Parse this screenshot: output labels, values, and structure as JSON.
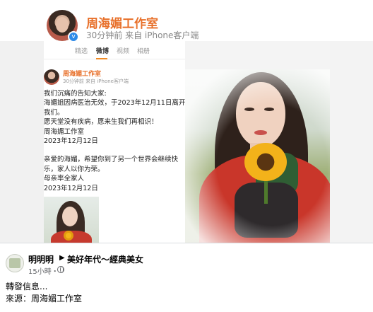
{
  "weibo_header": {
    "name": "周海媚工作室",
    "meta": "30分钟前 来自 iPhone客户端"
  },
  "tabs": [
    {
      "label": "精选"
    },
    {
      "label": "微博"
    },
    {
      "label": "视频"
    },
    {
      "label": "相册"
    }
  ],
  "post": {
    "name": "周海媚工作室",
    "meta": "30分钟前 来自 iPhone客户端",
    "lines": [
      "我们沉痛的告知大家:",
      "海媚姐因病医治无效，于2023年12月11日离开了",
      "我们。",
      "愿天堂没有疾病，愿来生我们再相识！",
      "周海媚工作室",
      "2023年12月12日",
      "",
      "亲爱的海媚，希望你到了另一个世界会继续快",
      "乐，家人以你为荣。",
      "母亲率全家人",
      "2023年12月12日"
    ]
  },
  "facebook": {
    "author": "明明明",
    "arrow": "▶",
    "group": "美好年代～經典美女",
    "time": "15小時・",
    "text_line1": "轉發信息...",
    "text_line2": "來源：周海媚工作室"
  }
}
